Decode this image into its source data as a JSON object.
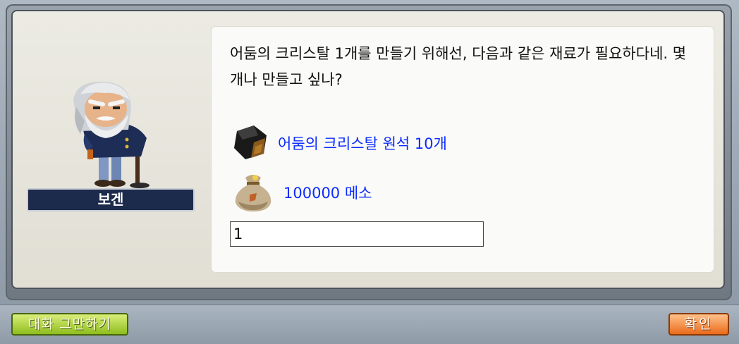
{
  "dialog": {
    "message": "어둠의 크리스탈 1개를 만들기 위해선, 다음과 같은 재료가 필요하다네. 몇개나 만들고 싶나?",
    "materials": [
      {
        "icon": "dark-crystal-ore-icon",
        "label": "어둠의 크리스탈 원석 10개"
      },
      {
        "icon": "meso-bag-icon",
        "label": "100000 메소"
      }
    ],
    "quantity_value": "1"
  },
  "npc": {
    "name": "보겐"
  },
  "buttons": {
    "end_chat": "대화 그만하기",
    "confirm": "확인"
  },
  "colors": {
    "material_text": "#0b2bff",
    "nameplate_bg": "#1c2b4c",
    "end_button": "#a8d030",
    "confirm_button": "#f07d2a"
  }
}
